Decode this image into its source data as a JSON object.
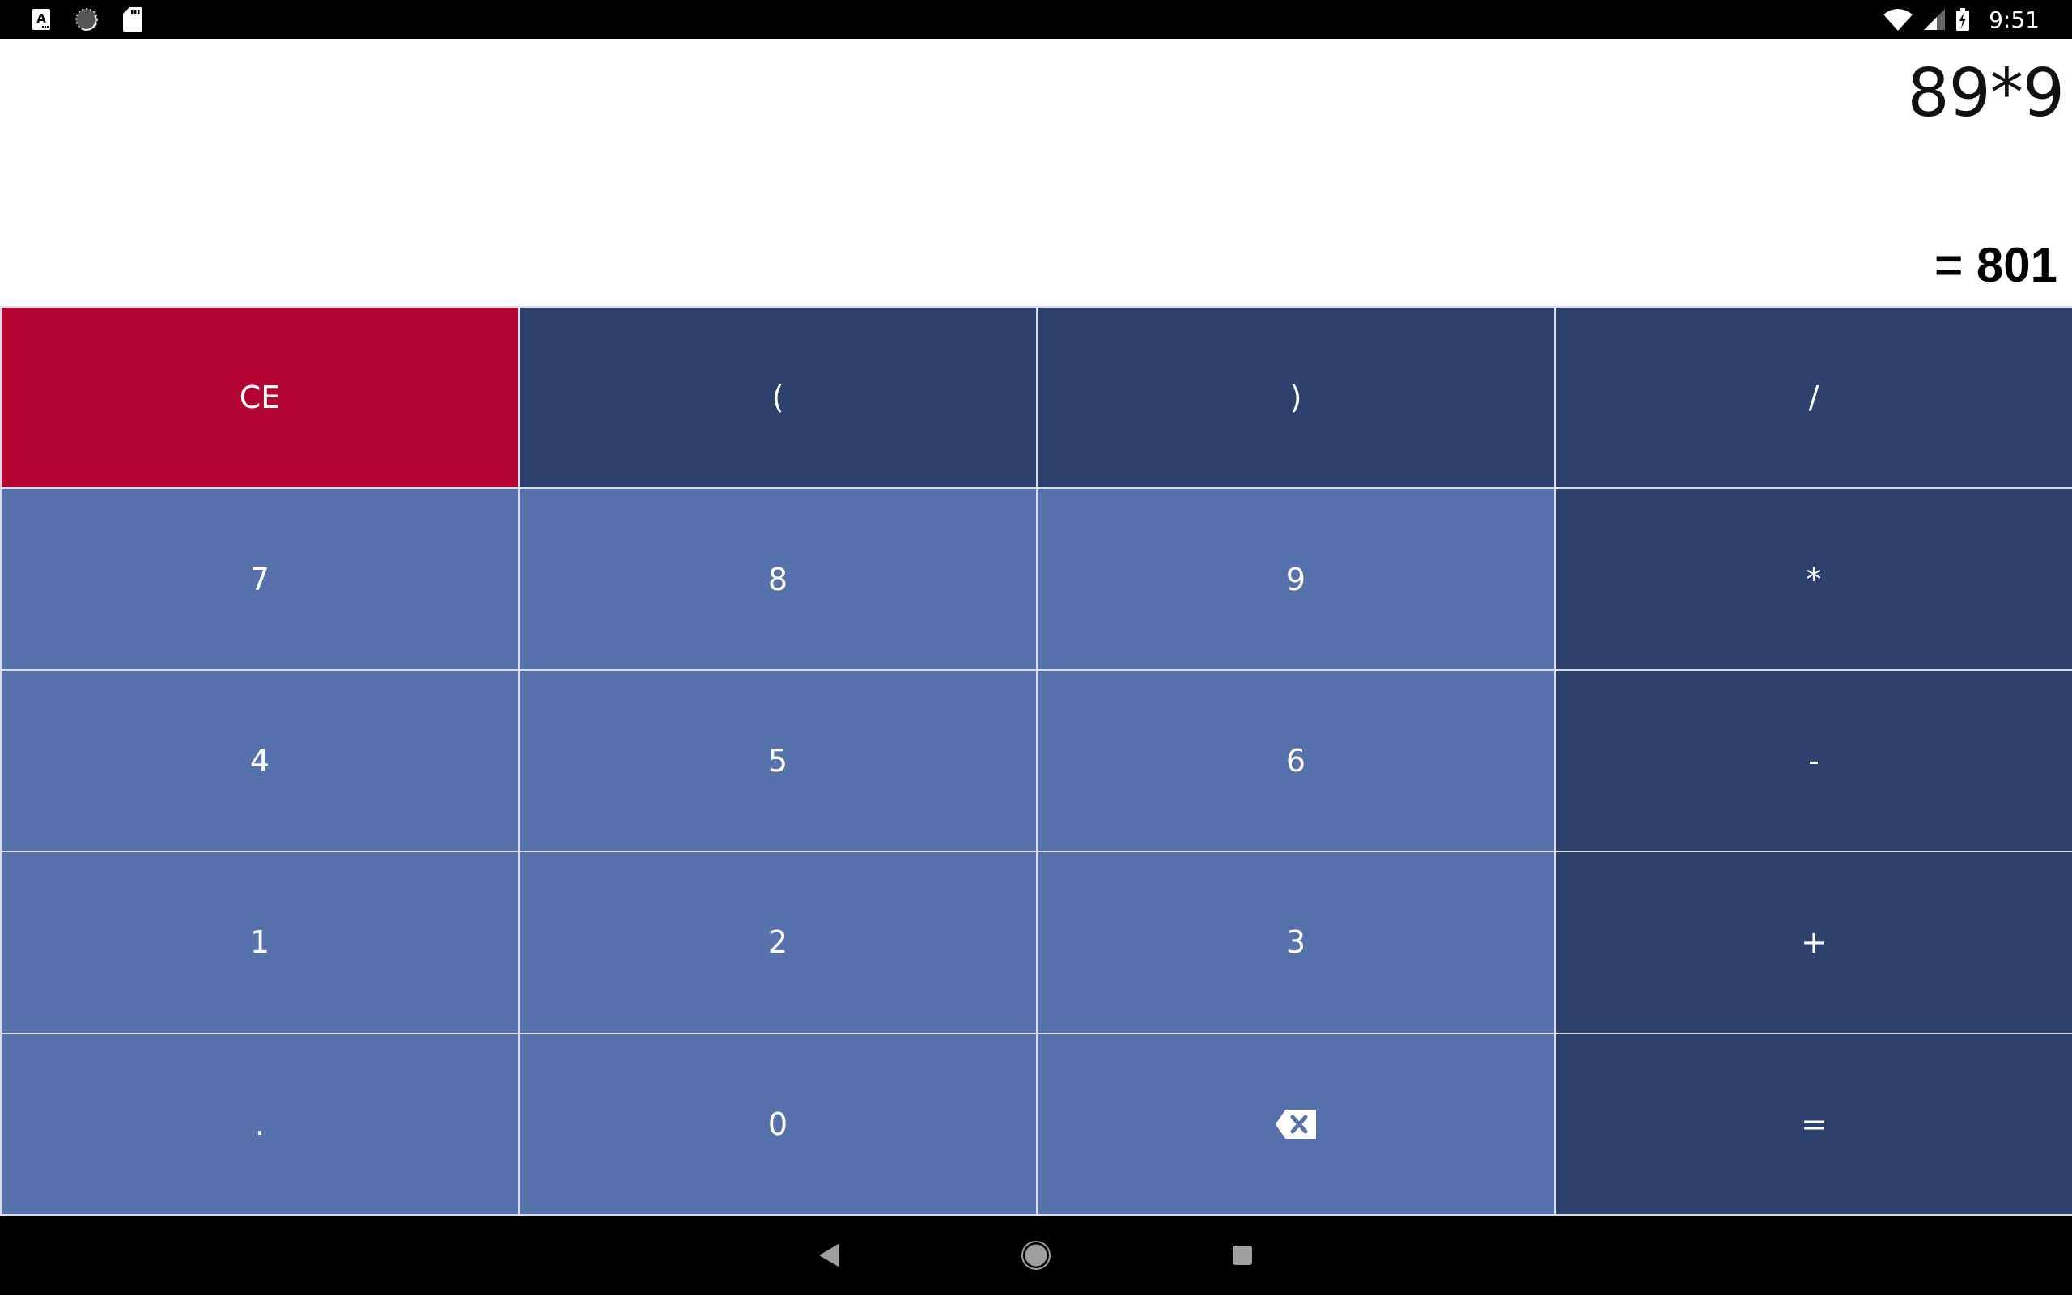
{
  "status_bar": {
    "left_icons": [
      "text-notification-icon",
      "sync-icon",
      "sd-card-icon"
    ],
    "right_icons": [
      "wifi-icon",
      "cellular-signal-icon",
      "battery-charging-icon"
    ],
    "time": "9:51"
  },
  "display": {
    "expression": "89*9",
    "result": "= 801"
  },
  "keypad": {
    "keys": [
      {
        "label": "CE",
        "type": "clear",
        "name": "clear-entry-button"
      },
      {
        "label": "(",
        "type": "op",
        "name": "open-paren-button"
      },
      {
        "label": ")",
        "type": "op",
        "name": "close-paren-button"
      },
      {
        "label": "/",
        "type": "op",
        "name": "divide-button"
      },
      {
        "label": "7",
        "type": "digit",
        "name": "digit-7-button"
      },
      {
        "label": "8",
        "type": "digit",
        "name": "digit-8-button"
      },
      {
        "label": "9",
        "type": "digit",
        "name": "digit-9-button"
      },
      {
        "label": "*",
        "type": "op",
        "name": "multiply-button"
      },
      {
        "label": "4",
        "type": "digit",
        "name": "digit-4-button"
      },
      {
        "label": "5",
        "type": "digit",
        "name": "digit-5-button"
      },
      {
        "label": "6",
        "type": "digit",
        "name": "digit-6-button"
      },
      {
        "label": "-",
        "type": "op",
        "name": "subtract-button"
      },
      {
        "label": "1",
        "type": "digit",
        "name": "digit-1-button"
      },
      {
        "label": "2",
        "type": "digit",
        "name": "digit-2-button"
      },
      {
        "label": "3",
        "type": "digit",
        "name": "digit-3-button"
      },
      {
        "label": "+",
        "type": "op",
        "name": "add-button"
      },
      {
        "label": ".",
        "type": "digit",
        "name": "decimal-point-button"
      },
      {
        "label": "0",
        "type": "digit",
        "name": "digit-0-button"
      },
      {
        "label": "",
        "type": "digit",
        "name": "backspace-button",
        "icon": "backspace-icon"
      },
      {
        "label": "=",
        "type": "op",
        "name": "equals-button"
      }
    ]
  },
  "colors": {
    "clear": "#b10432",
    "operator": "#2e416d",
    "digit": "#5671ab",
    "separator": "#d8dce6"
  },
  "nav_bar": {
    "buttons": [
      "back",
      "home",
      "recents"
    ]
  }
}
